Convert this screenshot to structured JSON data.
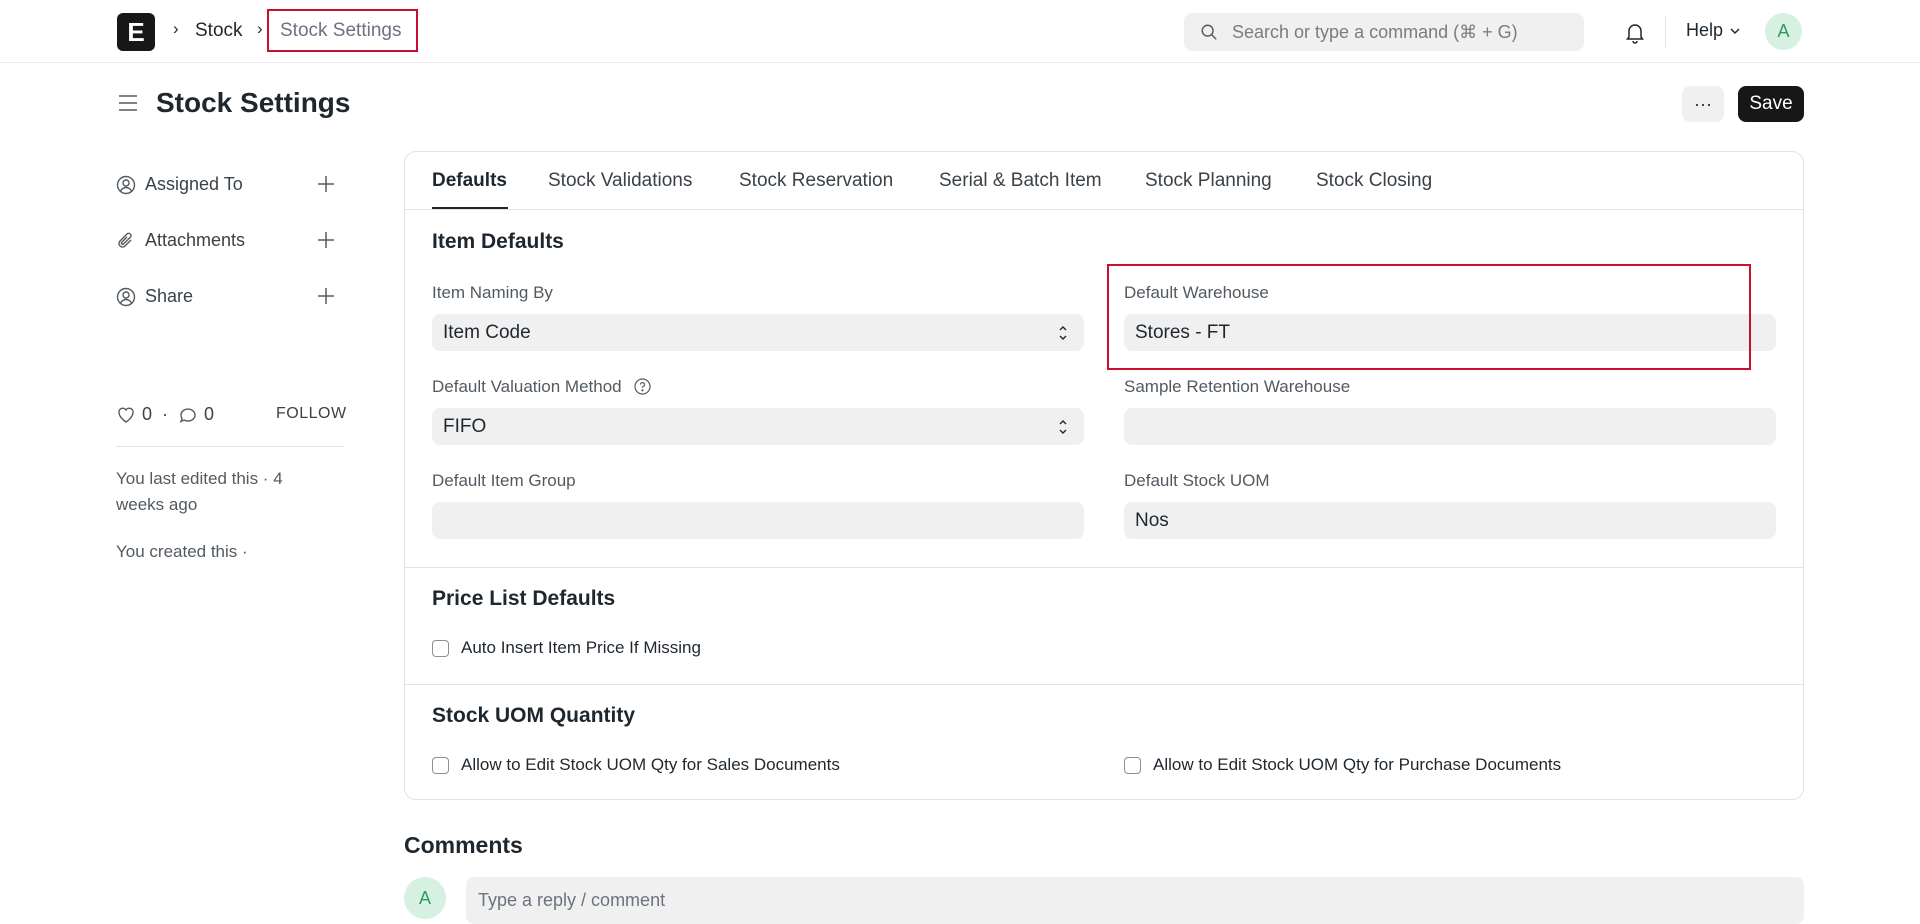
{
  "navbar": {
    "logo_letter": "E",
    "breadcrumbs": [
      "Stock",
      "Stock Settings"
    ],
    "search_placeholder": "Search or type a command (⌘ + G)",
    "help_label": "Help",
    "avatar_initial": "A"
  },
  "header": {
    "title": "Stock Settings",
    "more_label": "···",
    "save_label": "Save"
  },
  "sidebar": {
    "items": [
      {
        "label": "Assigned To",
        "icon": "assign-user-icon"
      },
      {
        "label": "Attachments",
        "icon": "paperclip-icon"
      },
      {
        "label": "Share",
        "icon": "share-user-icon"
      }
    ],
    "likes_count": "0",
    "comments_count": "0",
    "follow_label": "FOLLOW",
    "last_edited": "You last edited this · 4 weeks ago",
    "created": "You created this ·"
  },
  "tabs": [
    "Defaults",
    "Stock Validations",
    "Stock Reservation",
    "Serial & Batch Item",
    "Stock Planning",
    "Stock Closing"
  ],
  "active_tab": "Defaults",
  "sections": {
    "item_defaults": {
      "title": "Item Defaults",
      "item_naming_by": {
        "label": "Item Naming By",
        "value": "Item Code"
      },
      "default_warehouse": {
        "label": "Default Warehouse",
        "value": "Stores - FT"
      },
      "default_valuation_method": {
        "label": "Default Valuation Method",
        "value": "FIFO"
      },
      "sample_retention_warehouse": {
        "label": "Sample Retention Warehouse",
        "value": ""
      },
      "default_item_group": {
        "label": "Default Item Group",
        "value": ""
      },
      "default_stock_uom": {
        "label": "Default Stock UOM",
        "value": "Nos"
      }
    },
    "price_list_defaults": {
      "title": "Price List Defaults",
      "auto_insert_label": "Auto Insert Item Price If Missing",
      "auto_insert_checked": false
    },
    "stock_uom_quantity": {
      "title": "Stock UOM Quantity",
      "sales_label": "Allow to Edit Stock UOM Qty for Sales Documents",
      "purchase_label": "Allow to Edit Stock UOM Qty for Purchase Documents"
    }
  },
  "comments": {
    "title": "Comments",
    "avatar_initial": "A",
    "placeholder": "Type a reply / comment"
  },
  "colors": {
    "highlight": "#c8102e",
    "primary_button": "#171717",
    "avatar_bg": "#d6f0e1",
    "avatar_fg": "#2f9d62"
  }
}
